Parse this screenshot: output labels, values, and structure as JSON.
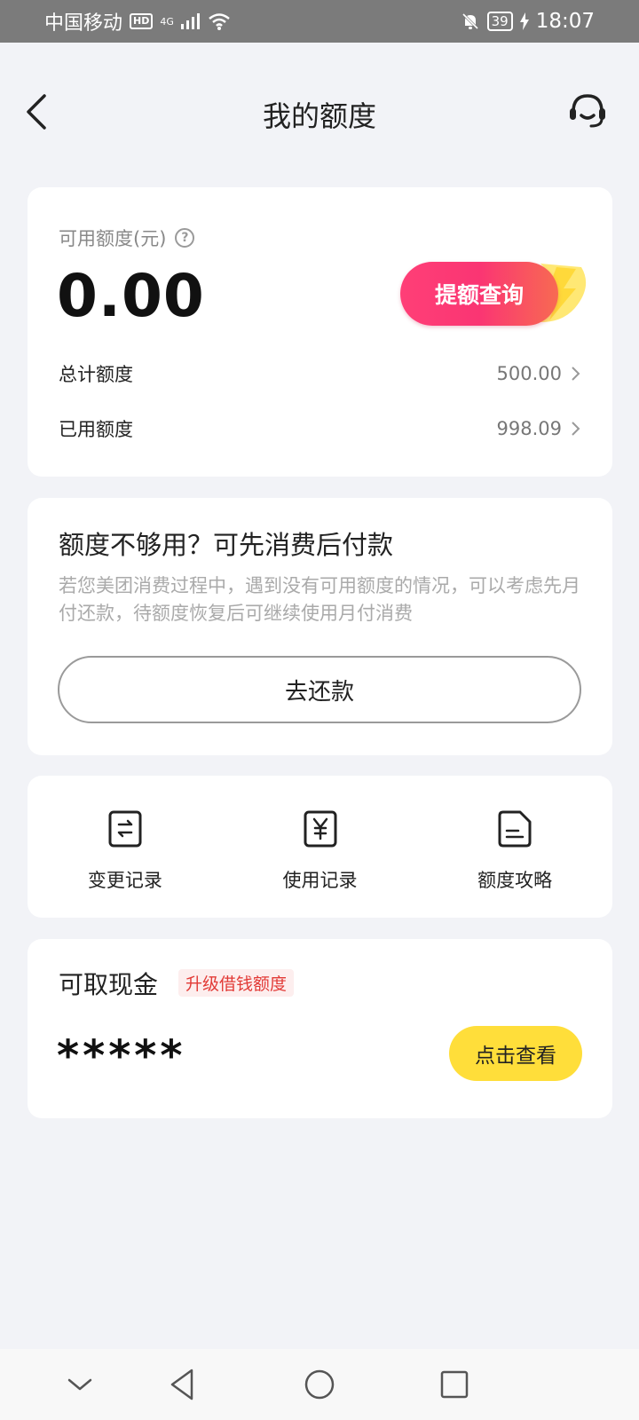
{
  "status_bar": {
    "carrier": "中国移动",
    "hd": "HD",
    "network": "4G",
    "battery": "39",
    "time": "18:07"
  },
  "header": {
    "title": "我的额度",
    "back_icon": "chevron-left-icon",
    "service_icon": "headset-icon"
  },
  "credit": {
    "available_label": "可用额度(元)",
    "available_amount": "0.00",
    "raise_button": "提额查询",
    "total_label": "总计额度",
    "total_value": "500.00",
    "used_label": "已用额度",
    "used_value": "998.09"
  },
  "pay_first": {
    "title": "额度不够用？可先消费后付款",
    "description": "若您美团消费过程中，遇到没有可用额度的情况，可以考虑先月付还款，待额度恢复后可继续使用月付消费",
    "repay_button": "去还款"
  },
  "actions": [
    {
      "label": "变更记录",
      "icon": "exchange-record-icon"
    },
    {
      "label": "使用记录",
      "icon": "yuan-record-icon"
    },
    {
      "label": "额度攻略",
      "icon": "document-guide-icon"
    }
  ],
  "cash": {
    "title": "可取现金",
    "badge": "升级借钱额度",
    "hidden_amount": "*****",
    "view_button": "点击查看"
  },
  "colors": {
    "accent_pink": "#fa3573",
    "button_yellow": "#ffde3a",
    "badge_red": "#e23a36",
    "background": "#f2f3f7"
  }
}
